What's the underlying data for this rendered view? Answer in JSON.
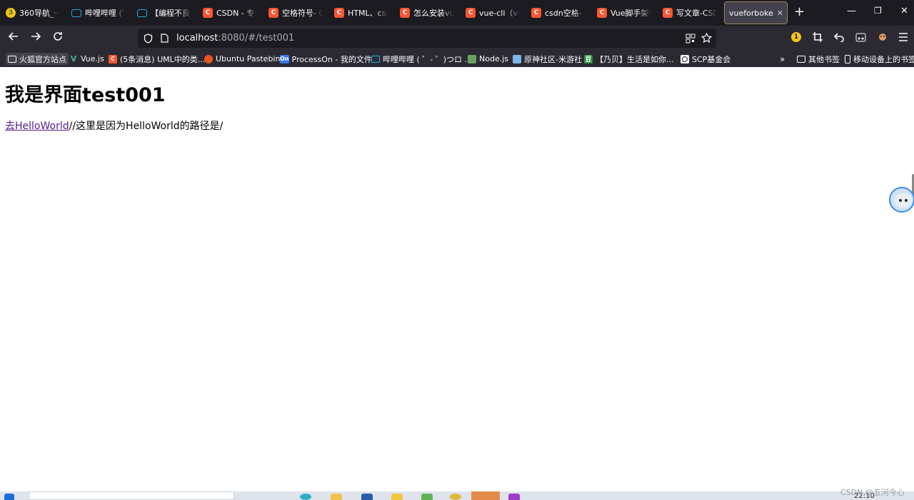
{
  "tabs": [
    {
      "label": "360导航_一",
      "favicon": "360",
      "active": false
    },
    {
      "label": "哔哩哔哩 (゜",
      "favicon": "bilibili",
      "active": false
    },
    {
      "label": "【编程不良人",
      "favicon": "bilibili",
      "active": false
    },
    {
      "label": "CSDN - 专业",
      "favicon": "csdn",
      "active": false
    },
    {
      "label": "空格符号- CS",
      "favicon": "csdn",
      "active": false
    },
    {
      "label": "HTML、css",
      "favicon": "csdn",
      "active": false
    },
    {
      "label": "怎么安装vue",
      "favicon": "csdn",
      "active": false
    },
    {
      "label": "vue-cli（vu",
      "favicon": "csdn",
      "active": false
    },
    {
      "label": "csdn空格- C",
      "favicon": "csdn",
      "active": false
    },
    {
      "label": "Vue脚手架安",
      "favicon": "csdn",
      "active": false
    },
    {
      "label": "写文章-CSD",
      "favicon": "csdn",
      "active": false
    },
    {
      "label": "vueforboke",
      "favicon": "none",
      "active": true
    }
  ],
  "url": {
    "host": "localhost",
    "rest": ":8080/#/test001"
  },
  "bookmarks": [
    {
      "label": "火狐官方站点",
      "icon": "folder-icon"
    },
    {
      "label": "Vue.js",
      "icon": "vue-icon"
    },
    {
      "label": "(5条消息) UML中的类...",
      "icon": "csdn-icon"
    },
    {
      "label": "Ubuntu Pastebin",
      "icon": "ubuntu-icon"
    },
    {
      "label": "ProcessOn - 我的文件",
      "icon": "processon-icon"
    },
    {
      "label": "哔哩哔哩 ( ゜- ゜)つロ ...",
      "icon": "bilibili-icon"
    },
    {
      "label": "Node.js",
      "icon": "nodejs-icon"
    },
    {
      "label": "原神社区-米游社",
      "icon": "miyoushe-icon"
    },
    {
      "label": "【乃贝】生活是如你...",
      "icon": "douban-icon"
    },
    {
      "label": "SCP基金会",
      "icon": "scp-icon"
    }
  ],
  "bookmarks_right": {
    "other": "其他书签",
    "mobile": "移动设备上的书签"
  },
  "toolbar": {
    "extension_badge": "1"
  },
  "page": {
    "heading": "我是界面test001",
    "link_text": "去HelloWorld",
    "note_text": "//这里是因为HelloWorld的路径是/"
  },
  "taskbar": {
    "clock": "22:10"
  },
  "watermark": "CSDN @五河今心"
}
